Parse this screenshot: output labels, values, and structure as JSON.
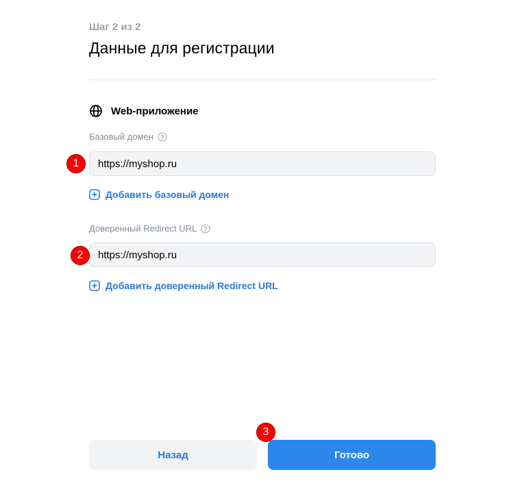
{
  "header": {
    "step": "Шаг 2 из 2",
    "title": "Данные для регистрации"
  },
  "section": {
    "title": "Web-приложение",
    "icon": "globe-icon"
  },
  "base_domain": {
    "label": "Базовый домен",
    "value": "https://myshop.ru",
    "add_label": "Добавить базовый домен"
  },
  "redirect_url": {
    "label": "Доверенный Redirect URL",
    "value": "https://myshop.ru",
    "add_label": "Добавить доверенный Redirect URL"
  },
  "annotations": [
    "1",
    "2",
    "3"
  ],
  "buttons": {
    "back": "Назад",
    "done": "Готово"
  },
  "colors": {
    "accent": "#2b87eb",
    "link": "#2b79d8",
    "badge": "#ff0000"
  }
}
